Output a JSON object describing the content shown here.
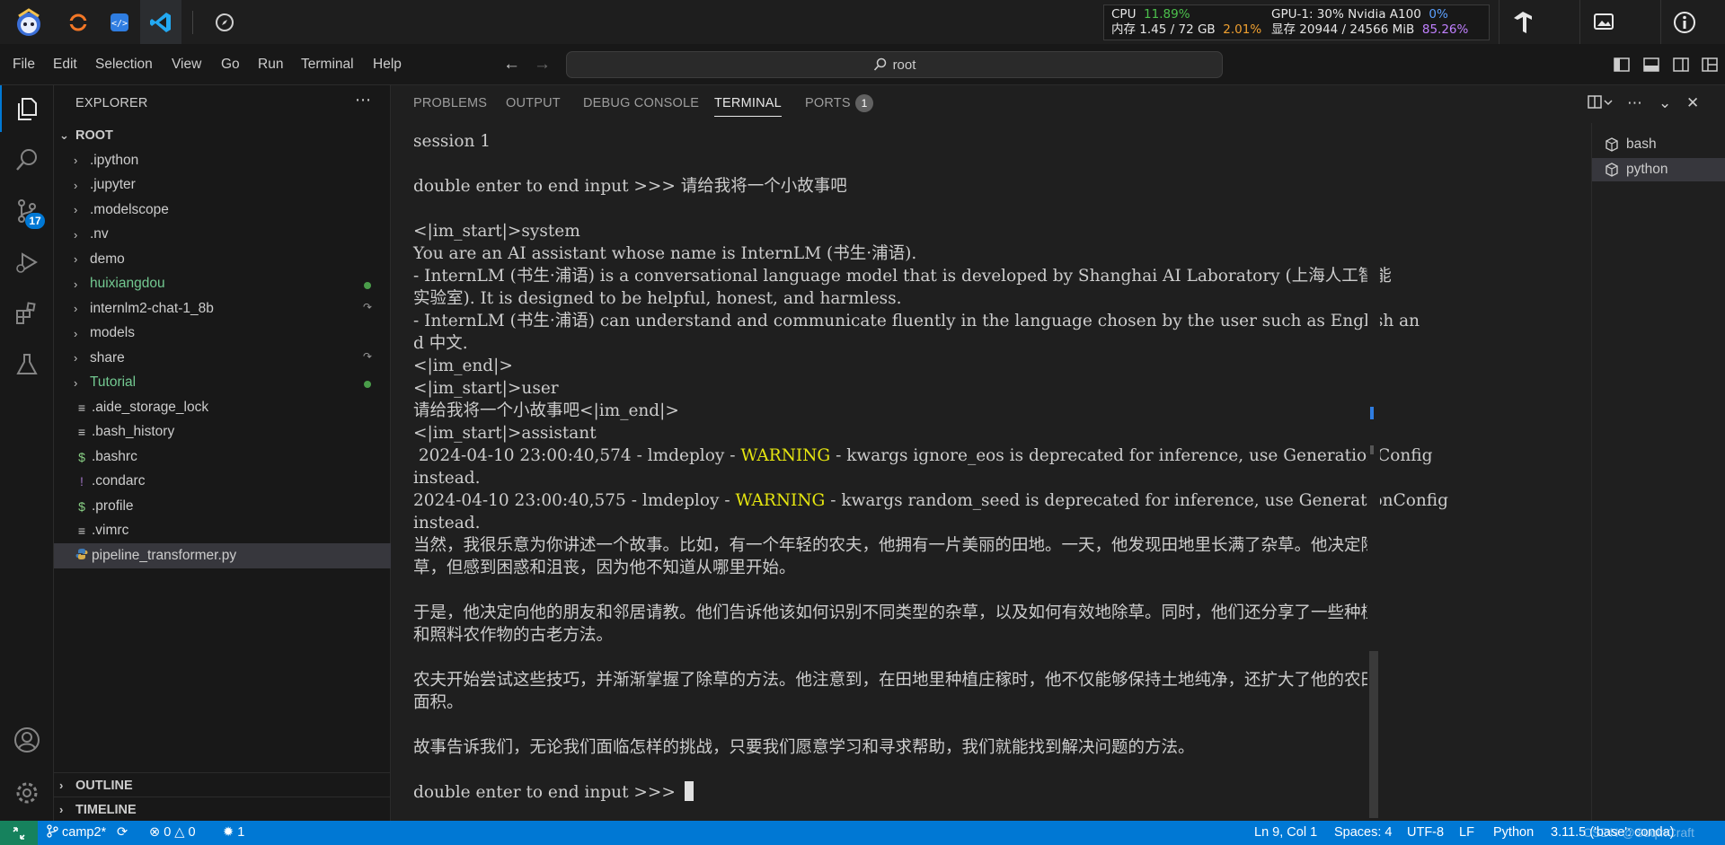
{
  "sysbar": {
    "stats": {
      "cpu_label": "CPU",
      "cpu_value": "11.89%",
      "mem_label": "内存",
      "mem_value": "1.45 / 72 GB",
      "mem_pct": "2.01%",
      "gpu_label": "GPU-1: 30% Nvidia A100",
      "gpu_pct": "0%",
      "vram_label": "显存",
      "vram_value": "20944 / 24566 MiB",
      "vram_pct": "85.26%"
    }
  },
  "menubar": {
    "items": [
      "File",
      "Edit",
      "Selection",
      "View",
      "Go",
      "Run",
      "Terminal",
      "Help"
    ],
    "command_center": "root"
  },
  "activity": {
    "scm_badge": "17"
  },
  "sidebar": {
    "title": "EXPLORER",
    "root_label": "ROOT",
    "items": [
      {
        "label": ".ipython",
        "type": "folder"
      },
      {
        "label": ".jupyter",
        "type": "folder"
      },
      {
        "label": ".modelscope",
        "type": "folder"
      },
      {
        "label": ".nv",
        "type": "folder"
      },
      {
        "label": "demo",
        "type": "folder"
      },
      {
        "label": "huixiangdou",
        "type": "folder"
      },
      {
        "label": "internlm2-chat-1_8b",
        "type": "folder"
      },
      {
        "label": "models",
        "type": "folder"
      },
      {
        "label": "share",
        "type": "folder"
      },
      {
        "label": "Tutorial",
        "type": "folder"
      },
      {
        "label": ".aide_storage_lock",
        "type": "file"
      },
      {
        "label": ".bash_history",
        "type": "file"
      },
      {
        "label": ".bashrc",
        "type": "file"
      },
      {
        "label": ".condarc",
        "type": "file"
      },
      {
        "label": ".profile",
        "type": "file"
      },
      {
        "label": ".vimrc",
        "type": "file"
      },
      {
        "label": "pipeline_transformer.py",
        "type": "file"
      }
    ],
    "outline_label": "OUTLINE",
    "timeline_label": "TIMELINE"
  },
  "panel": {
    "tabs": [
      "PROBLEMS",
      "OUTPUT",
      "DEBUG CONSOLE",
      "TERMINAL",
      "PORTS"
    ],
    "ports_count": "1",
    "terminal_lines": [
      "session 1",
      "",
      "double enter to end input >>> 请给我将一个小故事吧",
      "",
      "<|im_start|>system",
      "You are an AI assistant whose name is InternLM (书生·浦语).",
      "- InternLM (书生·浦语) is a conversational language model that is developed by Shanghai AI Laboratory (上海人工智能",
      "实验室). It is designed to be helpful, honest, and harmless.",
      "- InternLM (书生·浦语) can understand and communicate fluently in the language chosen by the user such as English an",
      "d 中文.",
      "<|im_end|>",
      "<|im_start|>user",
      "请给我将一个小故事吧<|im_end|>",
      "<|im_start|>assistant"
    ],
    "warn1_prefix": " 2024-04-10 23:00:40,574 - lmdeploy - ",
    "warn1_level": "WARNING",
    "warn1_suffix": " - kwargs ignore_eos is deprecated for inference, use GenerationConfig",
    "warn1_cont": "instead.",
    "warn2_prefix": "2024-04-10 23:00:40,575 - lmdeploy - ",
    "warn2_level": "WARNING",
    "warn2_suffix": " - kwargs random_seed is deprecated for inference, use GenerationConfig",
    "warn2_cont": "instead.",
    "story_lines": [
      "当然，我很乐意为你讲述一个故事。比如，有一个年轻的农夫，他拥有一片美丽的田地。一天，他发现田地里长满了杂草。他决定除",
      "草，但感到困惑和沮丧，因为他不知道从哪里开始。",
      "",
      "于是，他决定向他的朋友和邻居请教。他们告诉他该如何识别不同类型的杂草，以及如何有效地除草。同时，他们还分享了一些种植",
      "和照料农作物的古老方法。",
      "",
      "农夫开始尝试这些技巧，并渐渐掌握了除草的方法。他注意到，在田地里种植庄稼时，他不仅能够保持土地纯净，还扩大了他的农田",
      "面积。",
      "",
      "故事告诉我们，无论我们面临怎样的挑战，只要我们愿意学习和寻求帮助，我们就能找到解决问题的方法。",
      ""
    ],
    "prompt": "double enter to end input >>> ",
    "terminals": [
      "bash",
      "python"
    ]
  },
  "statusbar": {
    "branch": "camp2*",
    "errors": "0",
    "warnings": "0",
    "ports": "1",
    "position": "Ln 9, Col 1",
    "spaces": "Spaces: 4",
    "encoding": "UTF-8",
    "eol": "LF",
    "language": "Python",
    "interpreter": "3.11.5 ('base': conda)"
  },
  "watermark": "CSDN @SuqinCraft",
  "colors": {
    "accent": "#0078d4",
    "remote": "#16825d",
    "warning": "#e5e510",
    "git_added": "#73c991"
  }
}
